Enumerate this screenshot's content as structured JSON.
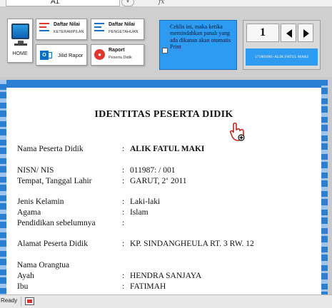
{
  "formula_bar": {
    "cell_ref": "A1",
    "fx_label": "fx"
  },
  "ribbon": {
    "home_label": "HOME",
    "daftar_nilai_keterampilan": {
      "title": "Daftar Nilai",
      "subtitle": "KETERAMPILAN"
    },
    "daftar_nilai_pengetahuan": {
      "title": "Daftar Nilai",
      "subtitle": "PENGETAHUAN"
    },
    "jilid_rapor_label": "Jilid Rapor",
    "raport": {
      "title": "Raport",
      "subtitle": "Peserta Didik"
    },
    "info_text": "Ceklis ini, maka ketika memindahkan panah yang ada dikanan akan otomatis Print",
    "page_number": "1",
    "student_id_label": "171801001-ALIK FATUL MAKI"
  },
  "document": {
    "title": "IDENTITAS PESERTA DIDIK",
    "fields": [
      {
        "label": "Nama Peserta Didik",
        "value": "ALIK FATUL MAKI",
        "bold": true
      },
      {
        "label": "NISN/ NIS",
        "value": "011987:        /              001",
        "bold": false
      },
      {
        "label": "Tempat, Tanggal Lahir",
        "value": "GARUT, 2‘          2011",
        "bold": false
      },
      {
        "label": "Jenis Kelamin",
        "value": "Laki-laki",
        "bold": false
      },
      {
        "label": "Agama",
        "value": "Islam",
        "bold": false
      },
      {
        "label": "Pendidikan sebelumnya",
        "value": "",
        "bold": false
      },
      {
        "label": "Alamat Peserta Didik",
        "value": "KP. SINDANGHEULA RT. 3 RW. 12",
        "bold": false
      },
      {
        "label": "Nama Orangtua",
        "value": null,
        "bold": false
      },
      {
        "label": "Ayah",
        "value": "HENDRA SANJAYA",
        "bold": false
      },
      {
        "label": "Ibu",
        "value": "FATIMAH",
        "bold": false
      }
    ]
  },
  "status_bar": {
    "ready": "Ready"
  },
  "colors": {
    "accent_blue": "#2e9bf0",
    "frame_blue": "#2a7fd4"
  },
  "icons": [
    "home-monitor-icon",
    "list-icon",
    "outlook-icon",
    "raport-icon",
    "arrow-left-icon",
    "arrow-right-icon",
    "hand-cursor-icon",
    "macro-icon"
  ]
}
